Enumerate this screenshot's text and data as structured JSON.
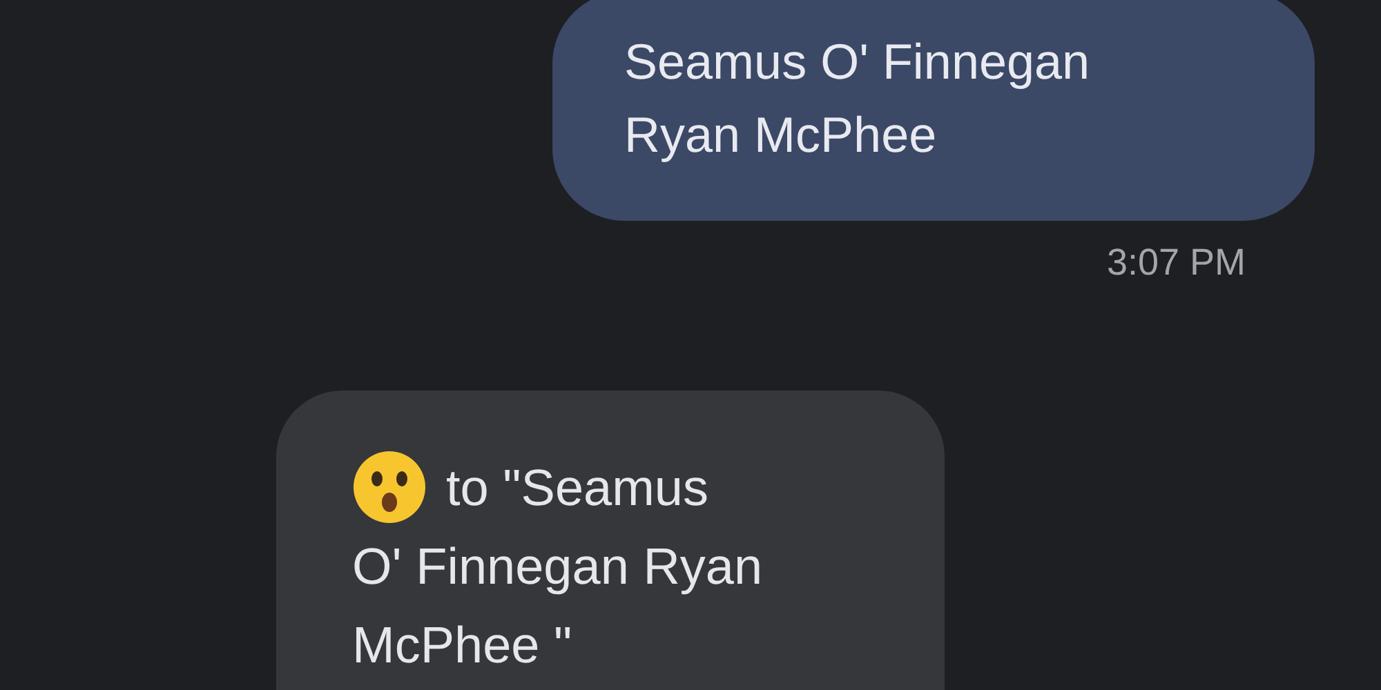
{
  "messages": [
    {
      "kind": "sent",
      "text": "Seamus O' Finnegan Ryan McPhee",
      "time": "3:07 PM"
    },
    {
      "kind": "reaction",
      "first_line": "to \"Seamus",
      "rest": "O' Finnegan Ryan McPhee \""
    }
  ]
}
